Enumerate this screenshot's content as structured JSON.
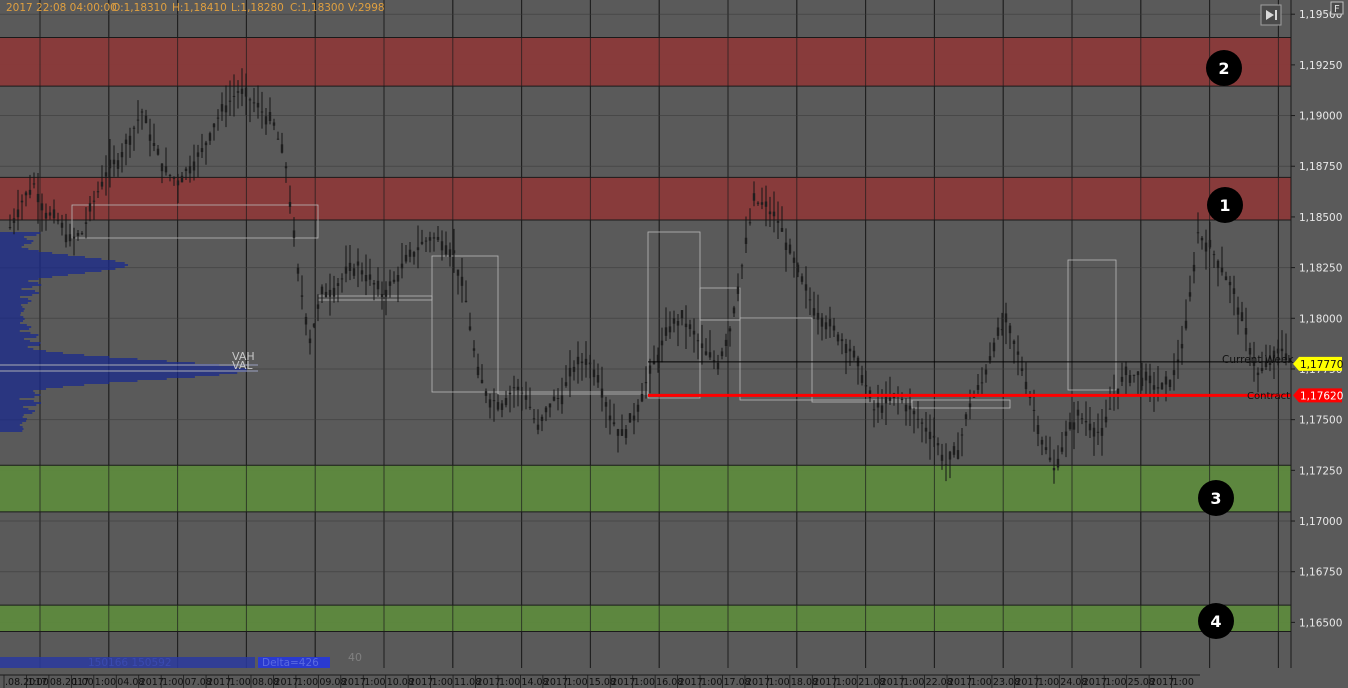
{
  "header": {
    "date": "2017 22:08 04:00:00",
    "open": "O:1,18310",
    "high": "H:1,18410",
    "low": "L:1,18280",
    "close": "C:1,18300",
    "volume": "V:2998"
  },
  "corner_label": "F",
  "profile_labels": {
    "vah": "VAH",
    "val": "VAL"
  },
  "footer": {
    "volume_text": "150166 150592",
    "delta_text": "Delta=426",
    "counter": "40"
  },
  "lines": {
    "current_week": {
      "label": "Current Week",
      "price_tag": "1,17770",
      "value": 1.1777,
      "color": "#000000",
      "tag_color": "#ffff00"
    },
    "contract": {
      "label": "Contract",
      "price_tag": "1,17620",
      "value": 1.1762,
      "color": "#ff0000",
      "tag_color": "#ff0000"
    }
  },
  "colors": {
    "resistance": "#8b3a3a",
    "support": "#5e8a3e",
    "profile": "#1a2a8c",
    "background": "#5a5a5a"
  },
  "zones": [
    {
      "number": "1",
      "kind": "resistance",
      "from": 1.18485,
      "to": 1.18695
    },
    {
      "number": "2",
      "kind": "resistance",
      "from": 1.19145,
      "to": 1.19385
    },
    {
      "number": "3",
      "kind": "support",
      "from": 1.17045,
      "to": 1.17275
    },
    {
      "number": "4",
      "kind": "support",
      "from": 1.16455,
      "to": 1.16585
    }
  ],
  "chart_data": {
    "type": "candlestick",
    "ylim": [
      1.16275,
      1.1957
    ],
    "y_ticks": [
      "1,19500",
      "1,19250",
      "1,19000",
      "1,18750",
      "1,18500",
      "1,18250",
      "1,18000",
      "1,17750",
      "1,17500",
      "1,17250",
      "1,17000",
      "1,16750",
      "1,16500"
    ],
    "y_tick_values": [
      1.195,
      1.1925,
      1.19,
      1.1875,
      1.185,
      1.1825,
      1.18,
      1.1775,
      1.175,
      1.1725,
      1.17,
      1.1675,
      1.165
    ],
    "x_tick_labels": [
      ".08.2017",
      "1:00",
      "08.2017",
      "1:00",
      "1:00",
      "04.08",
      "2017",
      "1:00",
      "07.08",
      "2017",
      "1:00",
      "08.08",
      "2017",
      "1:00",
      "09.08",
      "2017",
      "1:00",
      "10.08",
      "2017",
      "1:00",
      "11.08",
      "2017",
      "1:00",
      "14.08",
      "2017",
      "1:00",
      "15.08",
      "2017",
      "1:00",
      "16.08",
      "2017",
      "1:00",
      "17.08",
      "2017",
      "1:00",
      "18.08",
      "2017",
      "1:00",
      "21.08",
      "2017",
      "1:00",
      "22.08",
      "2017",
      "1:00",
      "23.08",
      "2017",
      "1:00",
      "24.08",
      "2017",
      "1:00",
      "25.08",
      "2017",
      "1:00"
    ],
    "price_path": [
      1.1845,
      1.1858,
      1.1866,
      1.1852,
      1.1848,
      1.1838,
      1.1842,
      1.1858,
      1.1872,
      1.1878,
      1.189,
      1.1902,
      1.1885,
      1.1872,
      1.1868,
      1.1875,
      1.1882,
      1.1896,
      1.1905,
      1.1912,
      1.1908,
      1.1902,
      1.1895,
      1.1875,
      1.1822,
      1.179,
      1.1812,
      1.1815,
      1.1822,
      1.1826,
      1.1819,
      1.1812,
      1.1818,
      1.1828,
      1.1835,
      1.184,
      1.1838,
      1.1832,
      1.1808,
      1.1772,
      1.176,
      1.1758,
      1.1766,
      1.1762,
      1.1745,
      1.1758,
      1.1762,
      1.1776,
      1.178,
      1.1772,
      1.1752,
      1.1742,
      1.1752,
      1.1768,
      1.1782,
      1.1796,
      1.18,
      1.1792,
      1.1782,
      1.1778,
      1.1795,
      1.1826,
      1.1858,
      1.1855,
      1.1848,
      1.1832,
      1.1818,
      1.1805,
      1.1798,
      1.1792,
      1.1785,
      1.1772,
      1.1755,
      1.1758,
      1.1762,
      1.1755,
      1.1748,
      1.1742,
      1.1728,
      1.1735,
      1.1758,
      1.1768,
      1.1788,
      1.1798,
      1.1782,
      1.1762,
      1.174,
      1.1725,
      1.1742,
      1.1752,
      1.1748,
      1.1742,
      1.1762,
      1.1772,
      1.1772,
      1.1768,
      1.1765,
      1.1772,
      1.1795,
      1.1842,
      1.1835,
      1.1825,
      1.1812,
      1.1792,
      1.1772,
      1.1778,
      1.1785,
      1.1778,
      1.1775
    ],
    "price_path_x": [
      10,
      22,
      34,
      46,
      58,
      70,
      82,
      94,
      106,
      118,
      130,
      142,
      154,
      166,
      178,
      190,
      202,
      214,
      226,
      238,
      250,
      262,
      274,
      286,
      298,
      310,
      322,
      334,
      346,
      358,
      370,
      382,
      394,
      406,
      418,
      430,
      442,
      454,
      466,
      478,
      490,
      502,
      514,
      526,
      538,
      550,
      562,
      574,
      586,
      598,
      610,
      622,
      634,
      646,
      658,
      670,
      682,
      694,
      706,
      718,
      730,
      742,
      754,
      766,
      778,
      790,
      802,
      814,
      826,
      838,
      850,
      862,
      874,
      886,
      898,
      910,
      922,
      934,
      946,
      958,
      970,
      982,
      994,
      1006,
      1018,
      1030,
      1042,
      1054,
      1066,
      1078,
      1090,
      1102,
      1114,
      1126,
      1138,
      1150,
      1162,
      1174,
      1186,
      1198,
      1210,
      1222,
      1234,
      1246,
      1258,
      1270,
      1282,
      1294,
      1306
    ]
  }
}
